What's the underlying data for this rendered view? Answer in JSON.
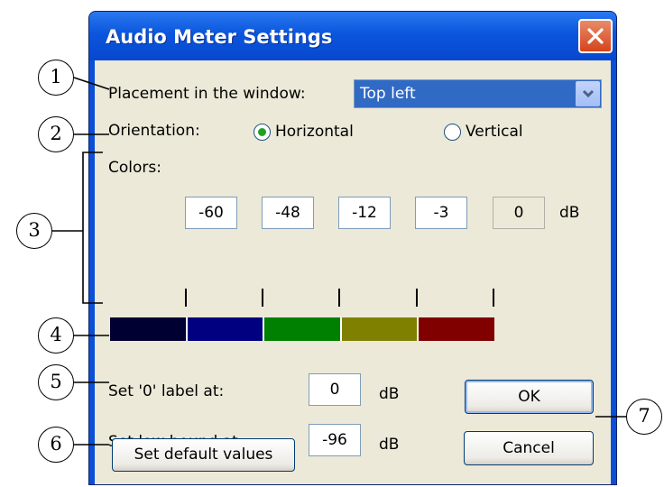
{
  "window": {
    "title": "Audio Meter Settings",
    "close_icon": "close-icon"
  },
  "placement": {
    "label": "Placement in the window:",
    "selected": "Top left",
    "arrow_icon": "chevron-down-icon"
  },
  "orientation": {
    "label": "Orientation:",
    "options": [
      {
        "label": "Horizontal",
        "checked": true
      },
      {
        "label": "Vertical",
        "checked": false
      }
    ]
  },
  "colors": {
    "label": "Colors:",
    "thresholds": [
      "-60",
      "-48",
      "-12",
      "-3",
      "0"
    ],
    "unit": "dB",
    "swatches": [
      "#000033",
      "#000080",
      "#008000",
      "#808000",
      "#800000"
    ]
  },
  "zero_label": {
    "label": "Set '0' label at:",
    "value": "0",
    "unit": "dB"
  },
  "low_bound": {
    "label": "Set low bound at:",
    "value": "-96",
    "unit": "dB"
  },
  "buttons": {
    "defaults": "Set default values",
    "ok": "OK",
    "cancel": "Cancel"
  },
  "callouts": [
    "1",
    "2",
    "3",
    "4",
    "5",
    "6",
    "7"
  ]
}
